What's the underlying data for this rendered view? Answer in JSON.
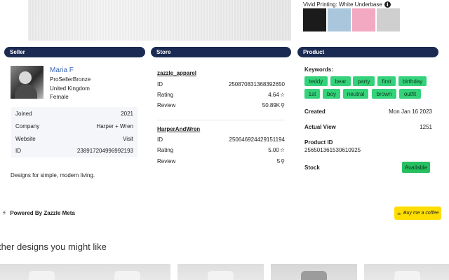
{
  "top": {
    "printing_label": "Vivid Printing: White Underbase",
    "swatches": [
      {
        "name": "black",
        "color": "#1b1b1b"
      },
      {
        "name": "light-blue",
        "color": "#a9c6dc"
      },
      {
        "name": "pink",
        "color": "#f2a9c1"
      },
      {
        "name": "heather-gray",
        "color": "#cfcfcf"
      }
    ]
  },
  "seller": {
    "header": "Seller",
    "name": "Maria F",
    "level": "ProSellerBronze",
    "country": "United Kingdom",
    "gender": "Female",
    "rows": [
      {
        "label": "Joined",
        "value": "2021"
      },
      {
        "label": "Company",
        "value": "Harper + Wren"
      },
      {
        "label": "Website",
        "value": "Visit"
      },
      {
        "label": "ID",
        "value": "238917204996992193"
      }
    ],
    "bio": "Designs for simple, modern living."
  },
  "store": {
    "header": "Store",
    "stores": [
      {
        "name": "zazzle_apparel",
        "id_label": "ID",
        "id": "250870831368392650",
        "rating_label": "Rating",
        "rating": "4.64",
        "review_label": "Review",
        "review": "50.89K"
      },
      {
        "name": "HarperAndWren",
        "id_label": "ID",
        "id": "250646924429151194",
        "rating_label": "Rating",
        "rating": "5.00",
        "review_label": "Review",
        "review": "5"
      }
    ]
  },
  "product": {
    "header": "Product",
    "keywords_label": "Keywords:",
    "keywords": [
      "teddy",
      "bear",
      "party",
      "first",
      "birthday",
      "1st",
      "boy",
      "neutral",
      "brown",
      "outfit"
    ],
    "created_label": "Created",
    "created": "Mon Jan 16 2023",
    "actual_view_label": "Actual View",
    "actual_view": "1251",
    "product_id_label": "Product ID",
    "product_id": "256501361530610925",
    "stock_label": "Stock",
    "stock": "Available"
  },
  "footer": {
    "powered_by": "Powered By Zazzle Meta",
    "coffee_label": "Buy me a coffee",
    "other_designs": "ther designs you might like"
  },
  "colors": {
    "header_bg": "#1b2a52",
    "tag_green": "#34d27a",
    "link_blue": "#3b66b0",
    "coffee_yellow": "#ffdd00"
  }
}
